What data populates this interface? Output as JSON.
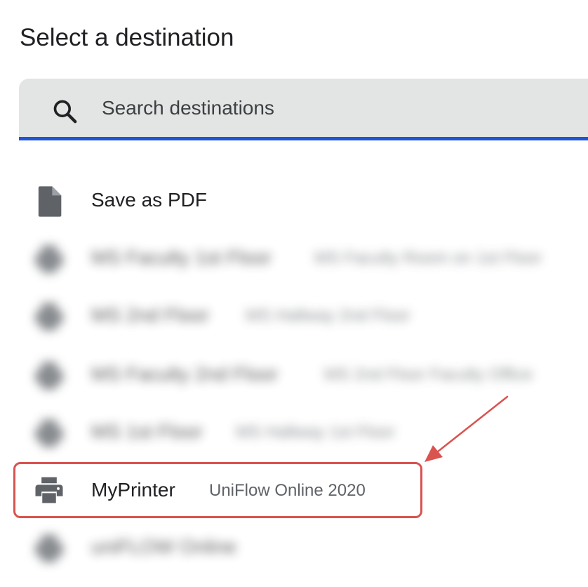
{
  "dialog": {
    "title": "Select a destination"
  },
  "search": {
    "placeholder": "Search destinations",
    "icon": "search-icon",
    "accent_color": "#1f55d6"
  },
  "destinations": [
    {
      "name": "Save as PDF",
      "description": "",
      "icon": "document-icon",
      "blurred": false
    },
    {
      "name": "MS Faculty 1st Floor",
      "description": "MS Faculty Room on 1st Floor",
      "icon": "printer-icon",
      "blurred": true
    },
    {
      "name": "MS 2nd Floor",
      "description": "MS Hallway 2nd Floor",
      "icon": "printer-icon",
      "blurred": true
    },
    {
      "name": "MS Faculty 2nd Floor",
      "description": "MS 2nd Floor Faculty Office",
      "icon": "printer-icon",
      "blurred": true
    },
    {
      "name": "MS 1st Floor",
      "description": "MS Hallway 1st Floor",
      "icon": "printer-icon",
      "blurred": true
    },
    {
      "name": "MyPrinter",
      "description": "UniFlow Online 2020",
      "icon": "printer-icon",
      "blurred": false,
      "highlighted": true
    },
    {
      "name": "uniFLOW Online",
      "description": "",
      "icon": "printer-icon",
      "blurred": true
    }
  ],
  "annotation": {
    "color": "#d9534f",
    "highlighted_item": "MyPrinter"
  }
}
